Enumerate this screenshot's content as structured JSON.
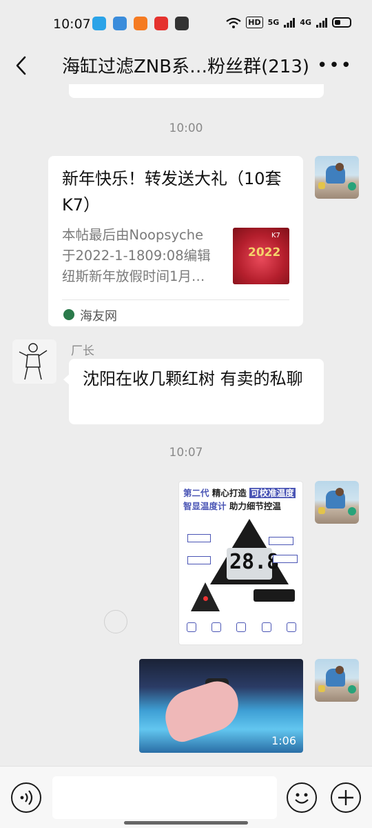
{
  "status_bar": {
    "time": "10:07",
    "hd_label": "HD",
    "net1": "5G",
    "net2": "4G",
    "icons": [
      "signal-5g-icon",
      "signal-4g-icon",
      "wifi-icon",
      "battery-icon"
    ]
  },
  "nav": {
    "title": "海缸过滤ZNB系…粉丝群(213)",
    "back_icon": "back-chevron-icon",
    "more_icon": "more-dots-icon"
  },
  "messages": {
    "timestamp_1": "10:00",
    "link_card": {
      "title": "新年快乐！转发送大礼（10套K7）",
      "desc_lines": [
        "本帖最后由Noopsyche",
        "于2022-1-1809:08编辑",
        "纽斯新年放假时间1月…"
      ],
      "source": "海友网",
      "thumb_text": "2022",
      "thumb_tag": "K7"
    },
    "sender_name": "厂长",
    "text_message": "沈阳在收几颗红树 有卖的私聊",
    "timestamp_2": "10:07",
    "image_message": {
      "line1_a": "第二代",
      "line1_b": "精心打造",
      "line1_c": "可校准温度",
      "line2_a": "智显温度计",
      "line2_b": "助力细节控温",
      "display_value": "28.8"
    },
    "video_message": {
      "duration": "1:06"
    }
  },
  "input_bar": {
    "voice_icon": "voice-icon",
    "emoji_icon": "emoji-icon",
    "plus_icon": "plus-icon"
  },
  "colors": {
    "background": "#ededed",
    "bubble": "#ffffff",
    "accent_blue": "#4a55b5"
  }
}
